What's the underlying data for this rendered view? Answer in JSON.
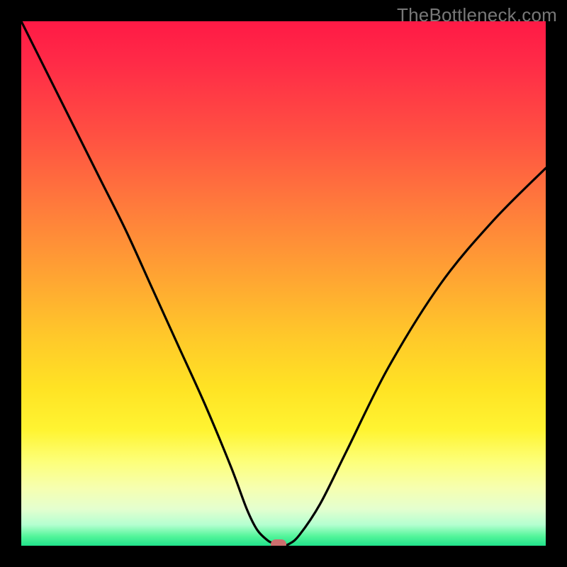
{
  "watermark": "TheBottleneck.com",
  "chart_data": {
    "type": "line",
    "title": "",
    "xlabel": "",
    "ylabel": "",
    "xlim": [
      0,
      100
    ],
    "ylim": [
      0,
      100
    ],
    "grid": false,
    "legend": false,
    "background": "rainbow-gradient",
    "series": [
      {
        "name": "bottleneck-curve",
        "x": [
          0,
          5,
          10,
          15,
          20,
          25,
          30,
          35,
          40,
          43,
          45,
          47,
          48,
          49,
          50,
          51,
          53,
          57,
          62,
          70,
          80,
          90,
          100
        ],
        "y": [
          100,
          90,
          80,
          70,
          60,
          49,
          38,
          27,
          15,
          7,
          3,
          1,
          0.5,
          0.2,
          0.1,
          0.3,
          2,
          8,
          18,
          34,
          50,
          62,
          72
        ]
      }
    ],
    "annotations": [
      {
        "name": "valley-marker",
        "x": 49,
        "y": 0.3,
        "shape": "pill",
        "color": "#cc6f6e"
      }
    ],
    "colors": {
      "curve": "#000000",
      "gradient_top": "#ff1a46",
      "gradient_mid": "#ffe324",
      "gradient_bottom": "#21e28b",
      "marker": "#cc6f6e",
      "frame": "#000000"
    }
  }
}
